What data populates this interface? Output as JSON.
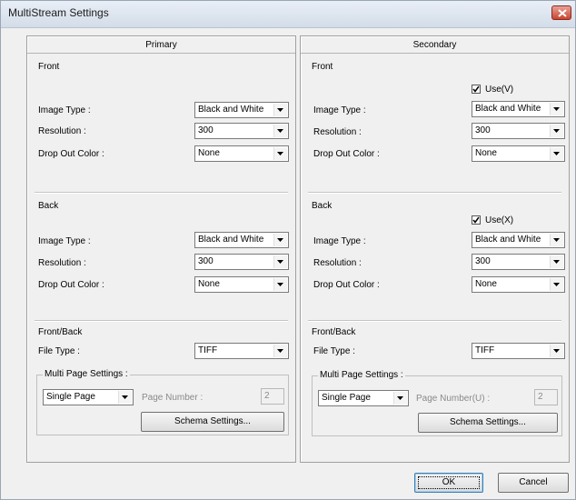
{
  "window": {
    "title": "MultiStream Settings",
    "close_icon": "close-icon"
  },
  "primary": {
    "title": "Primary",
    "front": {
      "section_label": "Front",
      "image_type": {
        "label": "Image Type :",
        "value": "Black and White"
      },
      "resolution": {
        "label": "Resolution :",
        "value": "300"
      },
      "dropout": {
        "label": "Drop Out Color :",
        "value": "None"
      }
    },
    "back": {
      "section_label": "Back",
      "image_type": {
        "label": "Image Type :",
        "value": "Black and White"
      },
      "resolution": {
        "label": "Resolution :",
        "value": "300"
      },
      "dropout": {
        "label": "Drop Out Color :",
        "value": "None"
      }
    },
    "frontback": {
      "section_label": "Front/Back",
      "file_type": {
        "label": "File Type :",
        "value": "TIFF"
      },
      "multipage_group": "Multi Page Settings :",
      "multipage_mode": "Single Page",
      "page_number_label": "Page Number :",
      "page_number": "2",
      "schema_button": "Schema Settings..."
    }
  },
  "secondary": {
    "title": "Secondary",
    "front": {
      "section_label": "Front",
      "use_label": "Use(V)",
      "use_checked": true,
      "image_type": {
        "label": "Image Type :",
        "value": "Black and White"
      },
      "resolution": {
        "label": "Resolution :",
        "value": "300"
      },
      "dropout": {
        "label": "Drop Out Color :",
        "value": "None"
      }
    },
    "back": {
      "section_label": "Back",
      "use_label": "Use(X)",
      "use_checked": true,
      "image_type": {
        "label": "Image Type :",
        "value": "Black and White"
      },
      "resolution": {
        "label": "Resolution :",
        "value": "300"
      },
      "dropout": {
        "label": "Drop Out Color :",
        "value": "None"
      }
    },
    "frontback": {
      "section_label": "Front/Back",
      "file_type": {
        "label": "File Type :",
        "value": "TIFF"
      },
      "multipage_group": "Multi Page Settings :",
      "multipage_mode": "Single Page",
      "page_number_label": "Page Number(U) :",
      "page_number": "2",
      "schema_button": "Schema Settings..."
    }
  },
  "buttons": {
    "ok": "OK",
    "cancel": "Cancel"
  }
}
